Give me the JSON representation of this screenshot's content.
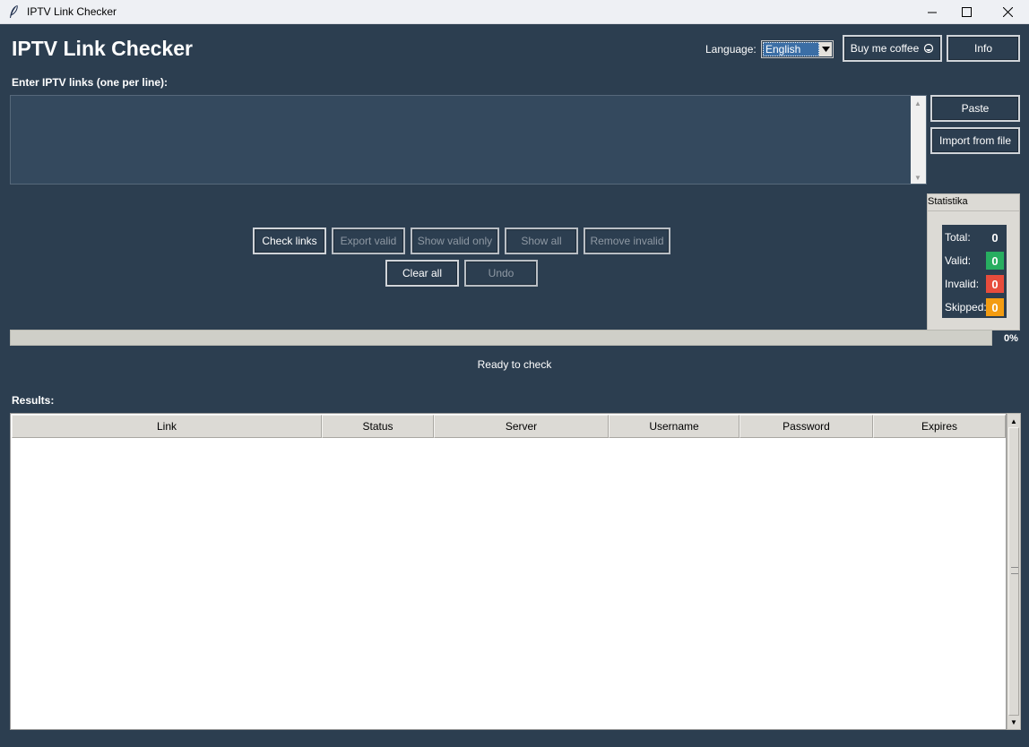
{
  "window": {
    "title": "IPTV Link Checker"
  },
  "header": {
    "title": "IPTV Link Checker",
    "language_label": "Language:",
    "language_value": "English",
    "coffee_label": "Buy me coffee",
    "info_label": "Info"
  },
  "input": {
    "label": "Enter IPTV links (one per line):",
    "value": "",
    "paste_label": "Paste",
    "import_label": "Import from file"
  },
  "actions": {
    "check_links": "Check links",
    "export_valid": "Export valid",
    "show_valid_only": "Show valid only",
    "show_all": "Show all",
    "remove_invalid": "Remove invalid",
    "clear_all": "Clear all",
    "undo": "Undo"
  },
  "stats": {
    "title": "Statistika",
    "total_label": "Total:",
    "total": "0",
    "valid_label": "Valid:",
    "valid": "0",
    "invalid_label": "Invalid:",
    "invalid": "0",
    "skipped_label": "Skipped:",
    "skipped": "0",
    "colors": {
      "valid": "#27ae60",
      "invalid": "#e74c3c",
      "skipped": "#f39c12"
    }
  },
  "progress": {
    "value": 0,
    "percent_text": "0%"
  },
  "status": {
    "text": "Ready to check"
  },
  "results": {
    "label": "Results:",
    "columns": [
      "Link",
      "Status",
      "Server",
      "Username",
      "Password",
      "Expires"
    ],
    "rows": []
  }
}
